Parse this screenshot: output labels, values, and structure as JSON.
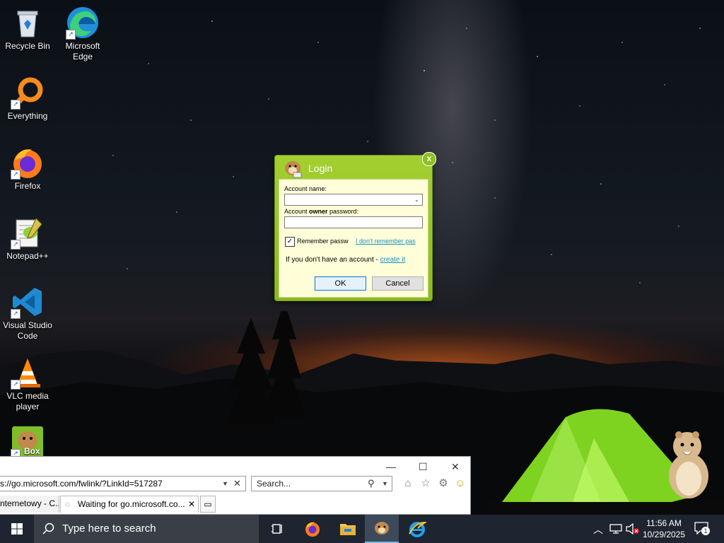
{
  "desktop": {
    "icons": [
      {
        "label": "Recycle Bin"
      },
      {
        "label": "Microsoft Edge"
      },
      {
        "label": "Everything"
      },
      {
        "label": "Firefox"
      },
      {
        "label": "Notepad++"
      },
      {
        "label": "Visual Studio Code"
      },
      {
        "label": "VLC media player"
      },
      {
        "label": "Box"
      }
    ]
  },
  "login": {
    "title": "Login",
    "account_name_label": "Account name:",
    "account_name_value": "",
    "password_label_prefix": "Account ",
    "password_label_bold": "owner",
    "password_label_suffix": " password:",
    "password_value": "",
    "remember_label": "Remember passw",
    "remember_checked": "✓",
    "forgot_link": "I don't remember pas",
    "no_account_text": "If you don't have an account - ",
    "create_link": "create it",
    "ok_label": "OK",
    "cancel_label": "Cancel",
    "close_glyph": "x"
  },
  "browser": {
    "address": "s://go.microsoft.com/fwlink/?LinkId=517287",
    "search_placeholder": "Search...",
    "tabs": [
      {
        "label": "nternetowy - C..."
      },
      {
        "label": "Waiting for go.microsoft.co..."
      }
    ],
    "close_tab_glyph": "✕",
    "minimize_glyph": "—",
    "maximize_glyph": "☐",
    "close_glyph": "✕"
  },
  "taskbar": {
    "search_placeholder": "Type here to search",
    "time": "11:56 AM",
    "date": "10/29/2025",
    "notification_count": "1"
  }
}
